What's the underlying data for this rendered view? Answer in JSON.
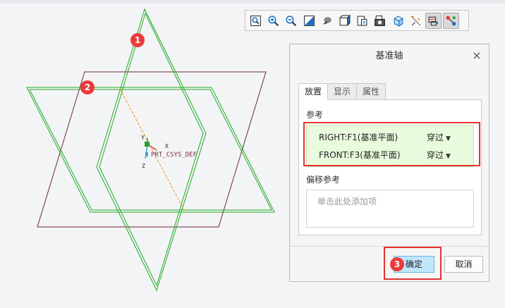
{
  "toolbar": {
    "buttons": [
      {
        "icon": "zoom-fit-icon"
      },
      {
        "icon": "zoom-in-icon"
      },
      {
        "icon": "zoom-out-icon"
      },
      {
        "icon": "repaint-icon"
      },
      {
        "icon": "display-style-icon"
      },
      {
        "icon": "view-orientation-icon"
      },
      {
        "icon": "saved-views-icon"
      },
      {
        "icon": "view-manager-icon"
      },
      {
        "icon": "perspective-icon"
      },
      {
        "icon": "datum-display-icon"
      },
      {
        "icon": "datum-planes-icon",
        "pressed": true
      },
      {
        "icon": "datum-axes-icon",
        "pressed": true
      }
    ]
  },
  "viewport": {
    "coord_label": "PRT_CSYS_DEF",
    "axis_labels": {
      "x": "X",
      "y": "Y",
      "z": "Z"
    }
  },
  "dialog": {
    "title": "基准轴",
    "close_glyph": "×",
    "tabs": [
      "放置",
      "显示",
      "属性"
    ],
    "active_tab": 0,
    "references_label": "参考",
    "references": [
      {
        "name": "RIGHT:F1(基准平面)",
        "type": "穿过"
      },
      {
        "name": "FRONT:F3(基准平面)",
        "type": "穿过"
      }
    ],
    "offset_label": "偏移参考",
    "offset_placeholder": "单击此处添加项",
    "ok_label": "确定",
    "cancel_label": "取消"
  },
  "annotations": {
    "badges": [
      "1",
      "2",
      "3"
    ]
  },
  "colors": {
    "accent_red": "#e53333",
    "plane_green": "#22aa22",
    "plane_maroon": "#6b2a35",
    "axis_orange": "#e8962e",
    "ok_button": "#bfe6fb",
    "reference_bg": "#e9fbdd"
  }
}
